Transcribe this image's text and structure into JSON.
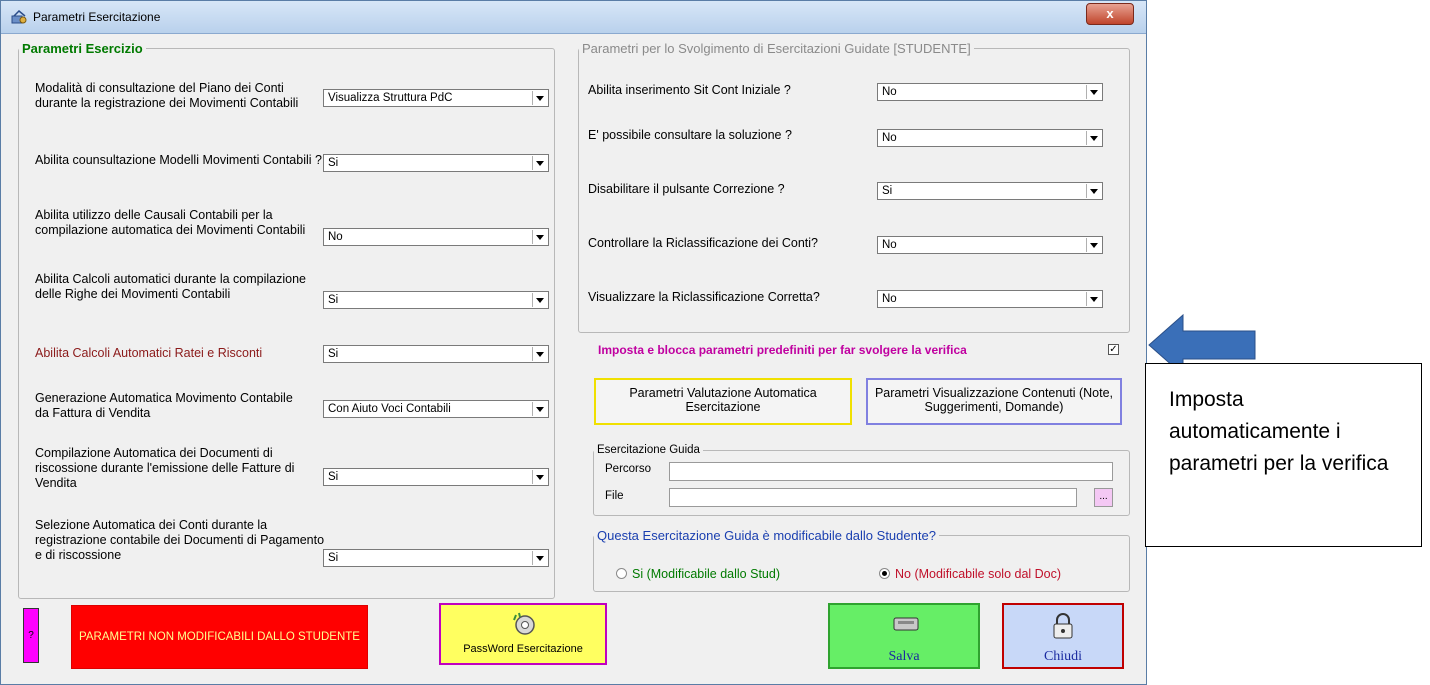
{
  "window": {
    "title": "Parametri Esercitazione",
    "close_label": "x"
  },
  "left_group": {
    "legend": "Parametri Esercizio",
    "rows": [
      {
        "label": "Modalità di consultazione del Piano dei Conti durante la registrazione dei Movimenti Contabili",
        "value": "Visualizza Struttura PdC"
      },
      {
        "label": "Abilita counsultazione Modelli Movimenti Contabili ?",
        "value": "Si"
      },
      {
        "label": "Abilita utilizzo delle Causali Contabili per la compilazione automatica dei Movimenti Contabili",
        "value": "No"
      },
      {
        "label": "Abilita Calcoli automatici durante la compilazione delle Righe dei Movimenti Contabili",
        "value": "Si"
      },
      {
        "label": "Abilita Calcoli Automatici Ratei e Risconti",
        "value": "Si"
      },
      {
        "label": "Generazione Automatica Movimento Contabile da Fattura di Vendita",
        "value": "Con Aiuto Voci Contabili"
      },
      {
        "label": "Compilazione Automatica dei Documenti di riscossione durante l'emissione delle Fatture di Vendita",
        "value": "Si"
      },
      {
        "label": "Selezione Automatica dei Conti durante la registrazione contabile dei Documenti di Pagamento e di riscossione",
        "value": "Si"
      }
    ]
  },
  "right_group": {
    "legend": "Parametri per lo Svolgimento di Esercitazioni Guidate [STUDENTE]",
    "rows": [
      {
        "label": "Abilita inserimento Sit Cont Iniziale ?",
        "value": "No"
      },
      {
        "label": "E' possibile consultare la soluzione ?",
        "value": "No"
      },
      {
        "label": "Disabilitare il pulsante Correzione ?",
        "value": "Si"
      },
      {
        "label": "Controllare la Riclassificazione dei Conti?",
        "value": "No"
      },
      {
        "label": "Visualizzare la Riclassificazione Corretta?",
        "value": "No"
      }
    ]
  },
  "preset": {
    "label": "Imposta e blocca parametri predefiniti per far svolgere la verifica",
    "checked_mark": "✓"
  },
  "buttons": {
    "valutazione": "Parametri Valutazione Automatica Esercitazione",
    "visualizzazione": "Parametri Visualizzazione Contenuti (Note, Suggerimenti, Domande)",
    "help": "?",
    "non_modificabili": "PARAMETRI NON MODIFICABILI DALLO STUDENTE",
    "password": "PassWord Esercitazione",
    "salva": "Salva",
    "chiudi": "Chiudi",
    "browse": "..."
  },
  "guida": {
    "legend": "Esercitazione Guida",
    "percorso_label": "Percorso",
    "file_label": "File",
    "percorso_value": "",
    "file_value": ""
  },
  "modificabile": {
    "legend": "Questa Esercitazione Guida è modificabile dallo Studente?",
    "option_yes": "Si (Modificabile dallo Stud)",
    "option_no": "No  (Modificabile solo dal Doc)",
    "selected": "No"
  },
  "callout": {
    "text": "Imposta automaticamente i parametri per la verifica"
  },
  "colors": {
    "legend_green": "#007a00",
    "red_label": "#8b1a1a",
    "magenta_label": "#c000a0",
    "callout_arrow": "#3a6fb8"
  }
}
